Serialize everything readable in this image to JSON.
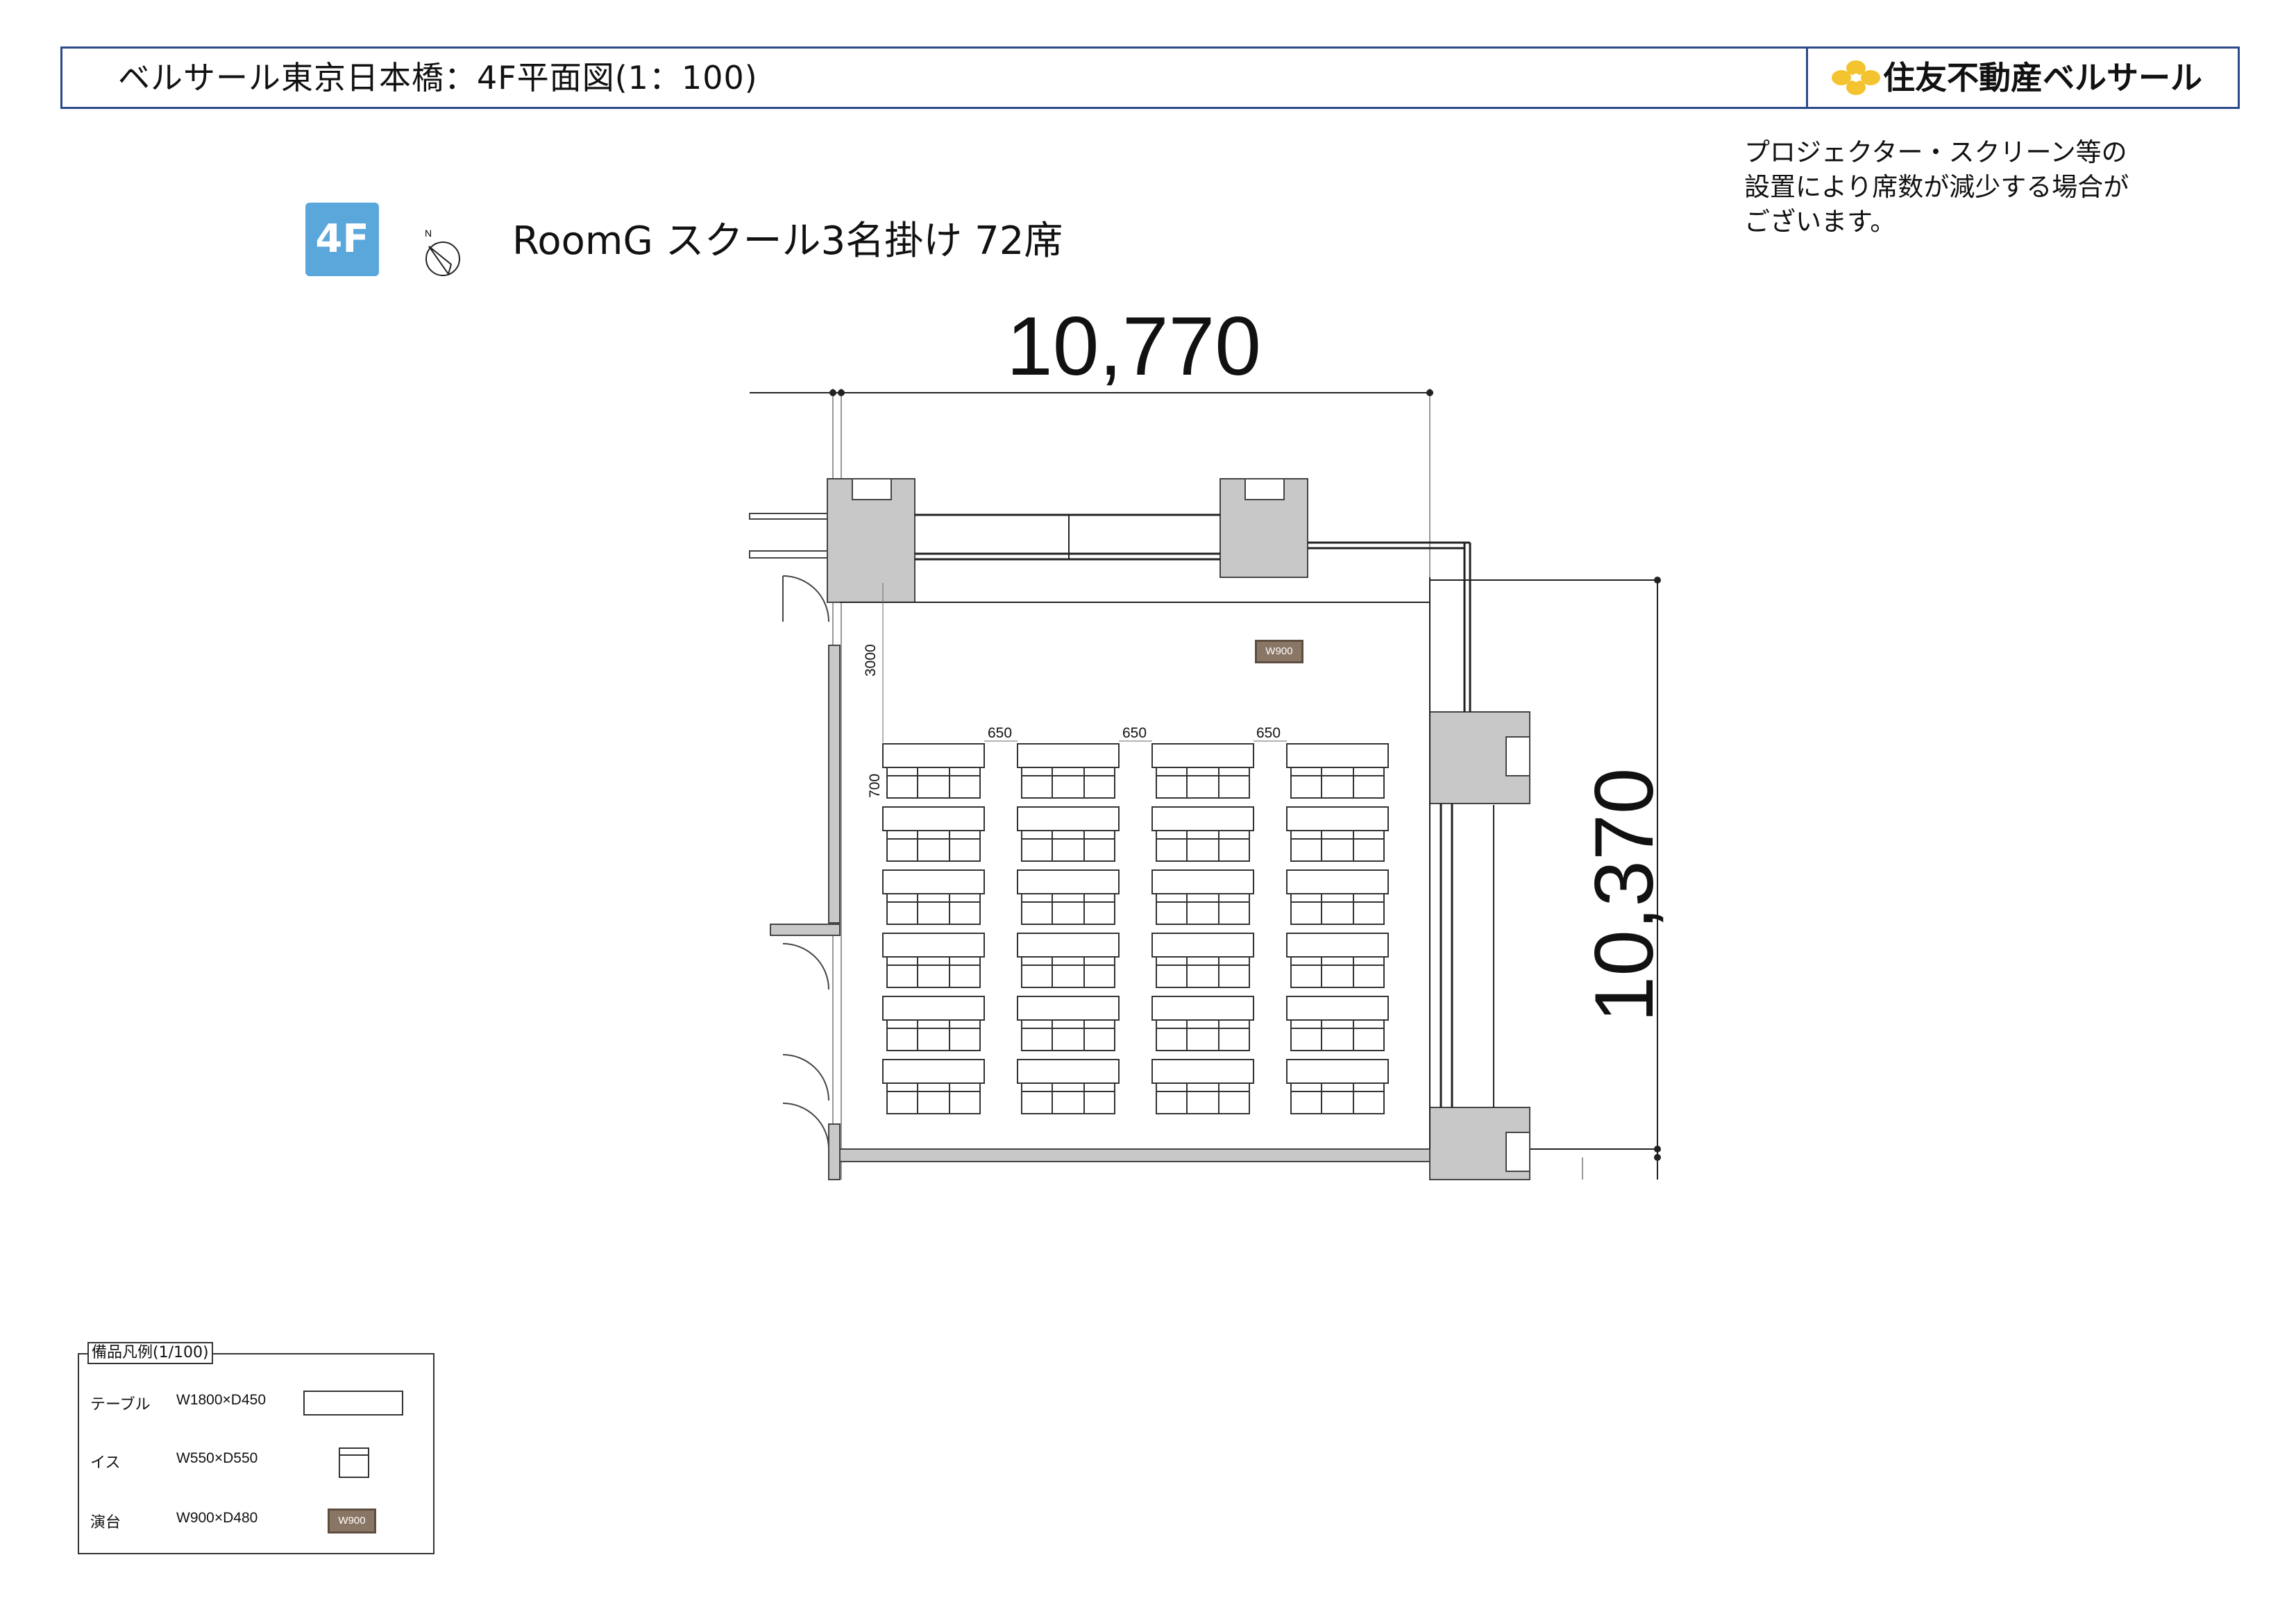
{
  "header": {
    "title": "ベルサール東京日本橋：4F平面図(1：100)",
    "brand": "住友不動産ベルサール"
  },
  "note": "プロジェクター・スクリーン等の設置により席数が減少する場合がございます。",
  "floor_badge": "4F",
  "north_label": "N",
  "room_title": "RoomG スクール3名掛け 72席",
  "dimensions": {
    "width": "10,770",
    "depth": "10,370",
    "aisle_gap": "650",
    "front_space": "3000",
    "row_pitch": "700"
  },
  "podium_label": "W900",
  "layout": {
    "table_columns": 4,
    "table_rows": 6,
    "seats_per_table": 3
  },
  "legend": {
    "title": "備品凡例(1/100)",
    "table": {
      "name": "テーブル",
      "size": "W1800×D450"
    },
    "chair": {
      "name": "イス",
      "size": "W550×D550"
    },
    "podium": {
      "name": "演台",
      "size": "W900×D480",
      "label": "W900"
    }
  },
  "colors": {
    "frame": "#2c4a8a",
    "badge": "#5aa7db",
    "logo": "#f4c430",
    "wall": "#c8c8c8",
    "podium": "#8a7664"
  }
}
